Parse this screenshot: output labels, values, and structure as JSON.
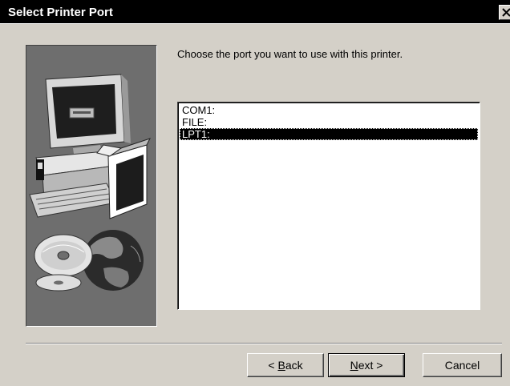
{
  "window": {
    "title": "Select Printer Port",
    "close_glyph": "×"
  },
  "content": {
    "instruction": "Choose the port you want to use with this printer.",
    "ports": [
      {
        "label": "COM1:",
        "selected": false
      },
      {
        "label": "FILE:",
        "selected": false
      },
      {
        "label": "LPT1:",
        "selected": true
      }
    ]
  },
  "buttons": {
    "back": {
      "pre": "< ",
      "mnemonic": "B",
      "post": "ack"
    },
    "next": {
      "pre": "",
      "mnemonic": "N",
      "post": "ext >"
    },
    "cancel": "Cancel"
  },
  "icons": {
    "illustration": "computer-with-box-and-cds-globe-icon",
    "close": "close-icon"
  },
  "colors": {
    "title_bar": "#000000",
    "face": "#d4d0c8",
    "illustration_bg": "#6e6e6e",
    "selection": "#000000"
  }
}
